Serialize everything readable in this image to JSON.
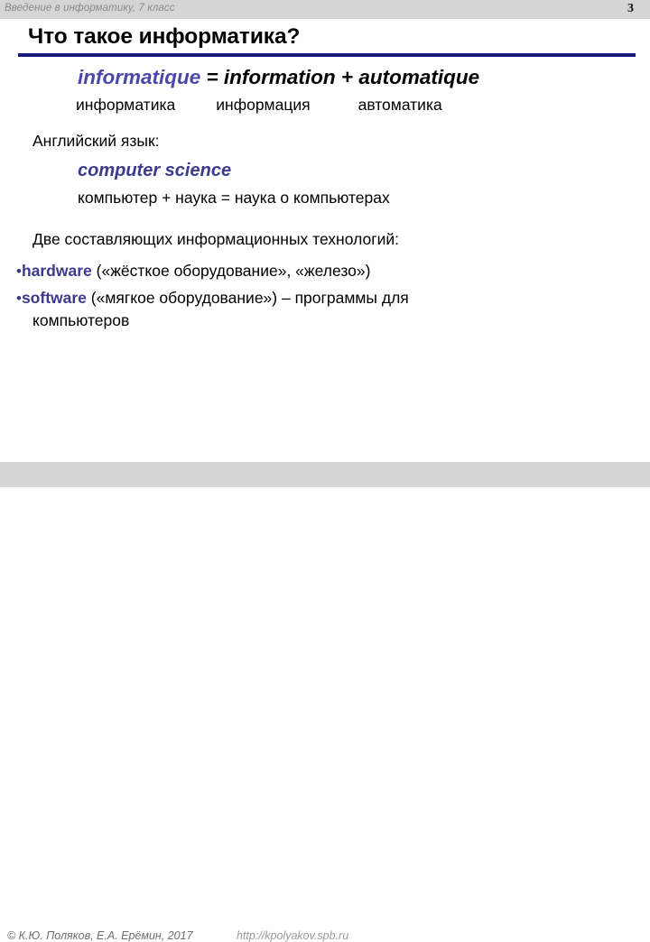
{
  "header": {
    "course": "Введение в информатику, 7 класс",
    "slide_number": "3"
  },
  "title": "Что такое информатика?",
  "formula": {
    "term_french": "informatique",
    "equals": " = ",
    "part_one": "information",
    "plus": " + ",
    "part_two": "automatique"
  },
  "translation": {
    "word_one": "информатика",
    "word_two": "информация",
    "word_three": "автоматика"
  },
  "english_section": {
    "label": "Английский язык:",
    "term": "computer science",
    "expansion": "компьютер  +  наука   =   наука о компьютерах"
  },
  "components": {
    "intro": "Две составляющих информационных технологий:",
    "bullet_glyph": "•",
    "items": [
      {
        "term": "hardware",
        "description": " («жёсткое оборудование», «железо»)"
      },
      {
        "term": "software",
        "description": " («мягкое оборудование») – программы для",
        "continuation": "компьютеров"
      }
    ]
  },
  "footer": {
    "copyright": "© К.Ю. Поляков, Е.А. Ерёмин, 2017",
    "url": "http://kpolyakov.spb.ru"
  },
  "colors": {
    "accent_purple": "#3c3a8c",
    "rule_navy": "#17177a",
    "bar_gray": "#d5d5d5"
  }
}
